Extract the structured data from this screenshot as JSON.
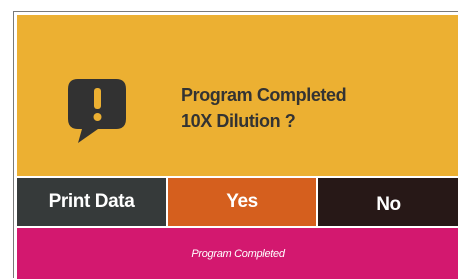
{
  "dialog": {
    "icon": "speech-bubble-exclamation-icon",
    "line1": "Program Completed",
    "line2": "10X Dilution ?"
  },
  "buttons": {
    "print_label": "Print Data",
    "yes_label": "Yes",
    "no_label": "No"
  },
  "status": {
    "text": "Program Completed"
  },
  "colors": {
    "dialog_bg": "#ecb032",
    "print_bg": "#363a3a",
    "yes_bg": "#d55f1e",
    "no_bg": "#271817",
    "status_bg": "#d3186f",
    "text_dark": "#333333"
  }
}
